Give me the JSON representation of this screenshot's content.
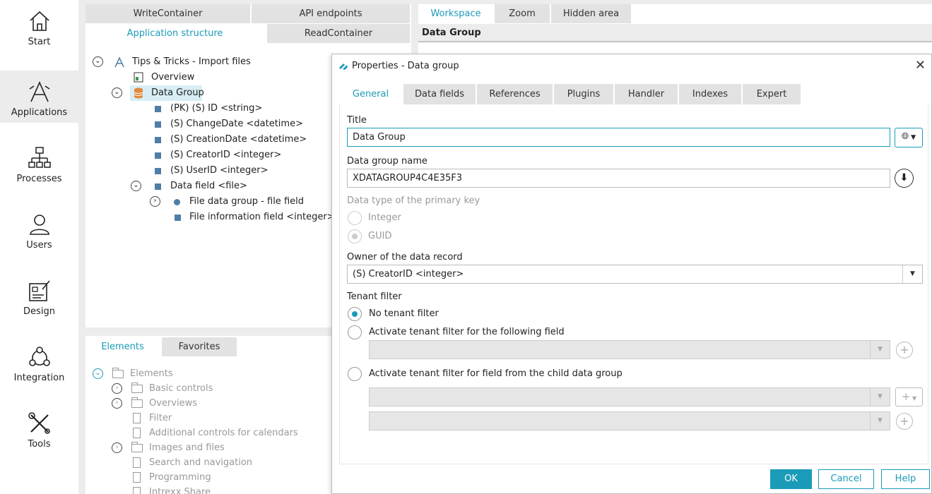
{
  "rail": {
    "items": [
      {
        "label": "Start",
        "icon": "home-icon"
      },
      {
        "label": "Applications",
        "icon": "applications-icon"
      },
      {
        "label": "Processes",
        "icon": "processes-icon"
      },
      {
        "label": "Users",
        "icon": "users-icon"
      },
      {
        "label": "Design",
        "icon": "design-icon"
      },
      {
        "label": "Integration",
        "icon": "integration-icon"
      },
      {
        "label": "Tools",
        "icon": "tools-icon"
      }
    ],
    "active": "Applications"
  },
  "structure_tabs": {
    "write_container": "WriteContainer",
    "api_endpoints": "API endpoints",
    "application_structure": "Application structure",
    "read_container": "ReadContainer"
  },
  "tree": {
    "root": "Tips & Tricks - Import files",
    "overview": "Overview",
    "data_group": "Data Group",
    "fields": [
      "(PK) (S) ID <string>",
      "(S) ChangeDate <datetime>",
      "(S) CreationDate <datetime>",
      "(S) CreatorID <integer>",
      "(S) UserID <integer>"
    ],
    "data_field": "Data field <file>",
    "file_data_group": "File data group - file field",
    "file_info_field": "File information field <integer>"
  },
  "elements_panel": {
    "tabs": {
      "elements": "Elements",
      "favorites": "Favorites"
    },
    "root": "Elements",
    "items": [
      "Basic controls",
      "Overviews",
      "Filter",
      "Additional controls for calendars",
      "Images and files",
      "Search and navigation",
      "Programming",
      "Intrexx Share"
    ]
  },
  "workspace": {
    "tabs": {
      "workspace": "Workspace",
      "zoom": "Zoom",
      "hidden_area": "Hidden area"
    },
    "header": "Data Group"
  },
  "dialog": {
    "title": "Properties - Data group",
    "tabs": [
      "General",
      "Data fields",
      "References",
      "Plugins",
      "Handler",
      "Indexes",
      "Expert"
    ],
    "title_label": "Title",
    "title_value": "Data Group",
    "group_name_label": "Data group name",
    "group_name_value": "XDATAGROUP4C4E35F3",
    "pk_type_label": "Data type of the primary key",
    "pk_integer": "Integer",
    "pk_guid": "GUID",
    "owner_label": "Owner of the data record",
    "owner_value": "(S) CreatorID <integer>",
    "tenant_label": "Tenant filter",
    "tenant_none": "No tenant filter",
    "tenant_field": "Activate tenant filter for the following field",
    "tenant_child": "Activate tenant filter for field from the child data group",
    "ok": "OK",
    "cancel": "Cancel",
    "help": "Help"
  },
  "colors": {
    "accent": "#1a9bb8",
    "field_square": "#4e7ea8",
    "data_group_icon": "#e08a3a"
  }
}
